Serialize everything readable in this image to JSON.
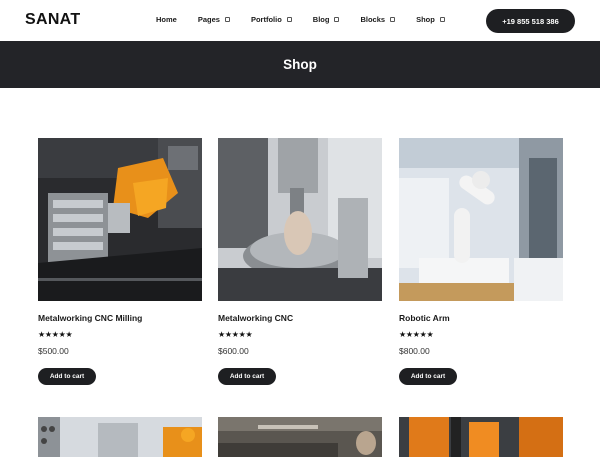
{
  "header": {
    "logo": "SANAT",
    "nav": [
      {
        "label": "Home",
        "has_dropdown": false
      },
      {
        "label": "Pages",
        "has_dropdown": true
      },
      {
        "label": "Portfolio",
        "has_dropdown": true
      },
      {
        "label": "Blog",
        "has_dropdown": true
      },
      {
        "label": "Blocks",
        "has_dropdown": true
      },
      {
        "label": "Shop",
        "has_dropdown": true
      }
    ],
    "phone": "+19 855 518 386"
  },
  "banner": {
    "title": "Shop"
  },
  "products": [
    {
      "title": "Metalworking CNC Milling",
      "stars": "★★★★★",
      "rating": 5,
      "price": "$500.00",
      "cart_label": "Add to cart",
      "image": "cnc-milling-photo"
    },
    {
      "title": "Metalworking CNC",
      "stars": "★★★★★",
      "rating": 5,
      "price": "$600.00",
      "cart_label": "Add to cart",
      "image": "cnc-machine-photo"
    },
    {
      "title": "Robotic Arm",
      "stars": "★★★★★",
      "rating": 5,
      "price": "$800.00",
      "cart_label": "Add to cart",
      "image": "robotic-arm-photo"
    }
  ],
  "colors": {
    "dark": "#1e1f22",
    "banner": "#232428",
    "accent_orange": "#e8901a"
  }
}
